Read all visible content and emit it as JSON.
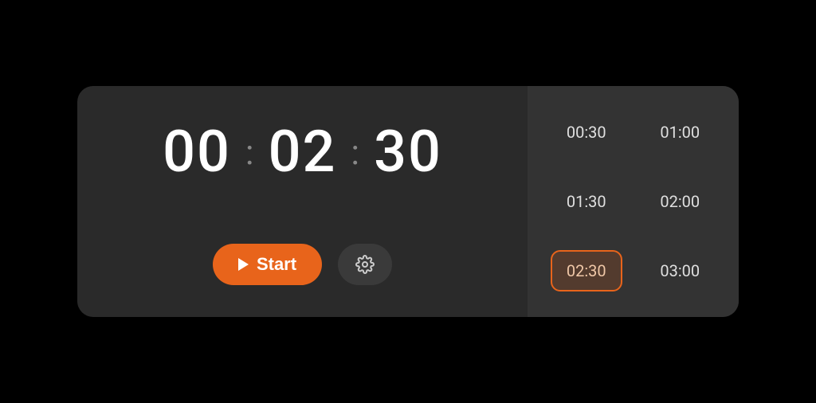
{
  "colors": {
    "accent": "#e8641b",
    "card_bg": "#2a2a2a",
    "sidebar_bg": "#333"
  },
  "timer": {
    "hours": "00",
    "minutes": "02",
    "seconds": "30"
  },
  "controls": {
    "start_label": "Start"
  },
  "presets": [
    {
      "label": "00:30",
      "active": false
    },
    {
      "label": "01:00",
      "active": false
    },
    {
      "label": "01:30",
      "active": false
    },
    {
      "label": "02:00",
      "active": false
    },
    {
      "label": "02:30",
      "active": true
    },
    {
      "label": "03:00",
      "active": false
    }
  ]
}
